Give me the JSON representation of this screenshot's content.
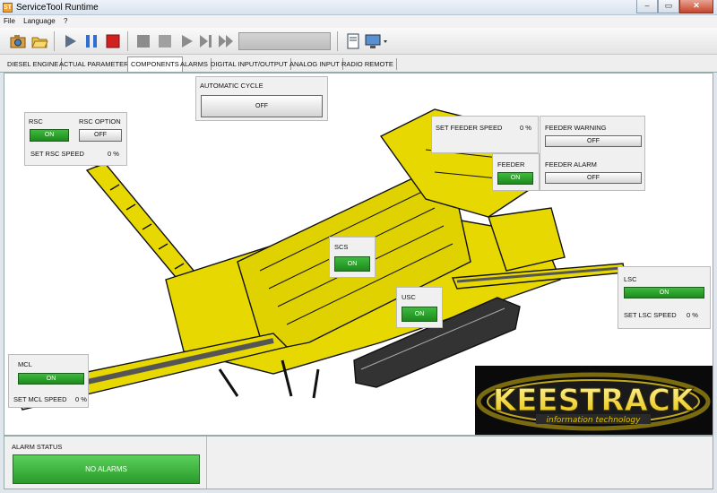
{
  "window": {
    "title": "ServiceTool Runtime",
    "app_icon": "ST"
  },
  "menu": [
    "File",
    "Language",
    "?"
  ],
  "toolbar_icons": [
    "camera-icon",
    "open-folder-icon",
    "play-icon",
    "pause-icon",
    "stop-icon",
    "stop-gray-icon",
    "stop-gray-icon",
    "play-gray-icon",
    "step-forward-icon",
    "fast-forward-icon",
    "document-icon",
    "monitor-icon"
  ],
  "tabs": [
    "DIESEL ENGINE",
    "ACTUAL PARAMETERS",
    "COMPONENTS",
    "ALARMS",
    "DIGITAL INPUT/OUTPUT",
    "ANALOG INPUT",
    "RADIO REMOTE"
  ],
  "active_tab": "COMPONENTS",
  "automatic_cycle": {
    "label": "AUTOMATIC CYCLE",
    "state": "OFF"
  },
  "rsc": {
    "label": "RSC",
    "state": "ON",
    "option_label": "RSC OPTION",
    "option_state": "OFF",
    "speed_label": "SET RSC SPEED",
    "speed_value": "0 %"
  },
  "feeder": {
    "speed_label": "SET FEEDER SPEED",
    "speed_value": "0 %",
    "warning_label": "FEEDER WARNING",
    "warning_state": "OFF",
    "label": "FEEDER",
    "state": "ON",
    "alarm_label": "FEEDER ALARM",
    "alarm_state": "OFF"
  },
  "scs": {
    "label": "SCS",
    "state": "ON"
  },
  "usc": {
    "label": "USC",
    "state": "ON"
  },
  "lsc": {
    "label": "LSC",
    "state": "ON",
    "speed_label": "SET LSC SPEED",
    "speed_value": "0 %"
  },
  "mcl": {
    "label": "MCL",
    "state": "ON",
    "speed_label": "SET MCL SPEED",
    "speed_value": "0 %"
  },
  "logo": {
    "brand": "KEESTRACK",
    "tagline": "information technology"
  },
  "alarm_status": {
    "label": "ALARM STATUS",
    "state": "NO ALARMS"
  },
  "colors": {
    "machine_yellow": "#e6d800",
    "on_green": "#2aa02a",
    "alarm_green": "#3fbf3f"
  }
}
